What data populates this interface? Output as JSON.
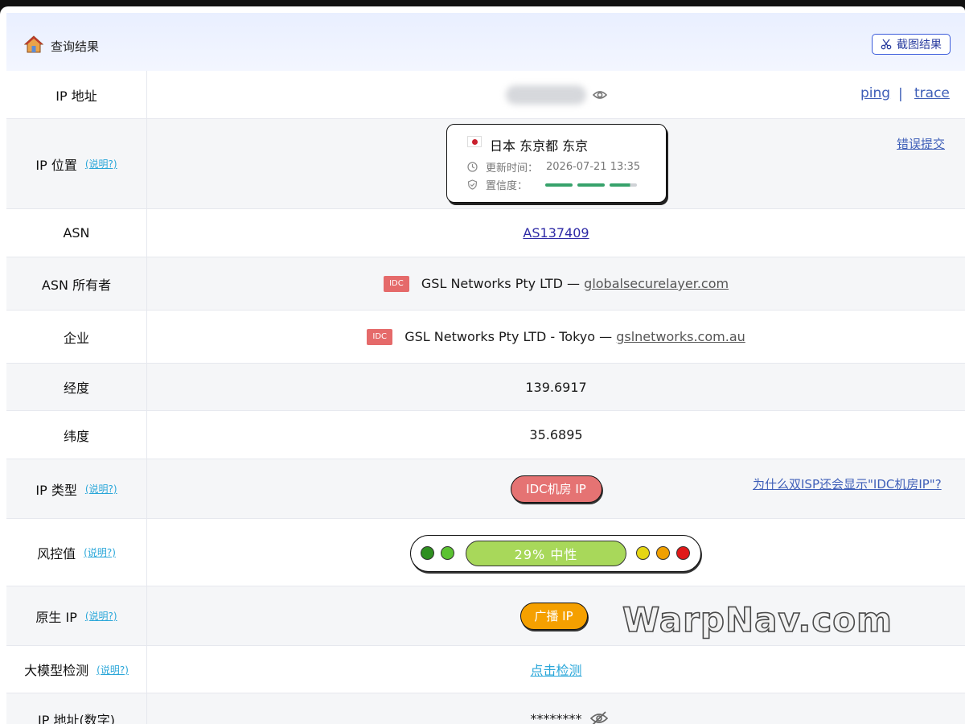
{
  "header": {
    "title": "查询结果",
    "screenshot_label": "截图结果"
  },
  "rows": {
    "ip": {
      "label": "IP 地址",
      "ping": "ping",
      "sep": "|",
      "trace": "trace"
    },
    "location": {
      "label": "IP 位置",
      "help": "(说明?)",
      "place": "日本 东京都 东京",
      "updated_label": "更新时间：",
      "updated_value": "2026-07-21 13:35",
      "confidence_label": "置信度：",
      "report": "错误提交"
    },
    "asn": {
      "label": "ASN",
      "value": "AS137409"
    },
    "asn_owner": {
      "label": "ASN 所有者",
      "badge": "IDC",
      "name": "GSL Networks Pty LTD —",
      "domain": "globalsecurelayer.com"
    },
    "company": {
      "label": "企业",
      "badge": "IDC",
      "name": "GSL Networks Pty LTD - Tokyo —",
      "domain": "gslnetworks.com.au"
    },
    "longitude": {
      "label": "经度",
      "value": "139.6917"
    },
    "latitude": {
      "label": "纬度",
      "value": "35.6895"
    },
    "ip_type": {
      "label": "IP 类型",
      "help": "(说明?)",
      "value": "IDC机房 IP",
      "link": "为什么双ISP还会显示\"IDC机房IP\"?"
    },
    "risk": {
      "label": "风控值",
      "help": "(说明?)",
      "value": "29%  中性",
      "percent": 29
    },
    "native_ip": {
      "label": "原生 IP",
      "help": "(说明?)",
      "value": "广播 IP"
    },
    "llm": {
      "label": "大模型检测",
      "help": "(说明?)",
      "value": "点击检测"
    },
    "ip_number": {
      "label": "IP 地址(数字)",
      "value": "********"
    }
  },
  "watermark": "WarpNav.com",
  "colors": {
    "accent": "#3b5bdb",
    "idc_red": "#e56a6a",
    "risk_green": "#a8d85a",
    "broadcast_orange": "#f5a000"
  }
}
